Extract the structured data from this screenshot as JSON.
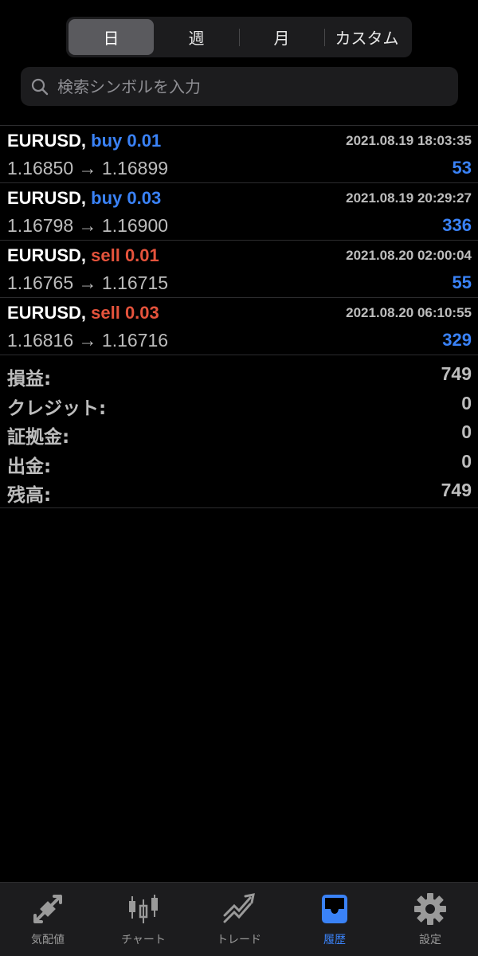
{
  "segments": [
    {
      "label": "日",
      "active": true
    },
    {
      "label": "週",
      "active": false
    },
    {
      "label": "月",
      "active": false
    },
    {
      "label": "カスタム",
      "active": false
    }
  ],
  "search": {
    "placeholder": "検索シンボルを入力"
  },
  "deals": [
    {
      "symbol": "EURUSD,",
      "side": "buy 0.01",
      "time": "2021.08.19 18:03:35",
      "prices": "1.16850 → 1.16899",
      "profit": "53"
    },
    {
      "symbol": "EURUSD,",
      "side": "buy 0.03",
      "time": "2021.08.19 20:29:27",
      "prices": "1.16798 → 1.16900",
      "profit": "336"
    },
    {
      "symbol": "EURUSD,",
      "side": "sell 0.01",
      "time": "2021.08.20 02:00:04",
      "prices": "1.16765 → 1.16715",
      "profit": "55"
    },
    {
      "symbol": "EURUSD,",
      "side": "sell 0.03",
      "time": "2021.08.20 06:10:55",
      "prices": "1.16816 → 1.16716",
      "profit": "329"
    }
  ],
  "summary": [
    {
      "label": "損益:",
      "value": "749"
    },
    {
      "label": "クレジット:",
      "value": "0"
    },
    {
      "label": "証拠金:",
      "value": "0"
    },
    {
      "label": "出金:",
      "value": "0"
    },
    {
      "label": "残高:",
      "value": "749"
    }
  ],
  "tabs": [
    {
      "label": "気配値",
      "icon": "quotes-icon",
      "active": false
    },
    {
      "label": "チャート",
      "icon": "chart-icon",
      "active": false
    },
    {
      "label": "トレード",
      "icon": "trade-icon",
      "active": false
    },
    {
      "label": "履歴",
      "icon": "history-icon",
      "active": true
    },
    {
      "label": "設定",
      "icon": "settings-icon",
      "active": false
    }
  ],
  "colors": {
    "buy": "#3a82f7",
    "sell": "#e5533c",
    "active_tab": "#3a82f7",
    "inactive": "#9a9a9a"
  }
}
